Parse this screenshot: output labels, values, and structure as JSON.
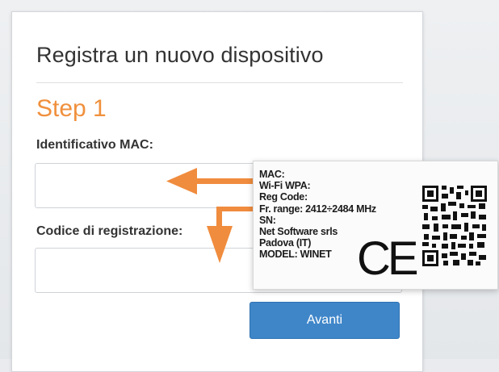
{
  "form": {
    "title": "Registra un nuovo dispositivo",
    "step": "Step 1",
    "mac_label": "Identificativo MAC:",
    "mac_value": "",
    "reg_label": "Codice di registrazione:",
    "reg_value": "",
    "next_button": "Avanti"
  },
  "device_label": {
    "lines": [
      "MAC:",
      "Wi-Fi WPA:",
      "Reg Code:",
      "Fr. range: 2412÷2484 MHz",
      "SN:",
      "Net Software srls",
      "Padova (IT)",
      "MODEL: WINET"
    ],
    "ce": "CE"
  },
  "colors": {
    "accent": "#f0903c",
    "button": "#3f86c9",
    "arrow": "#f08c3e"
  }
}
